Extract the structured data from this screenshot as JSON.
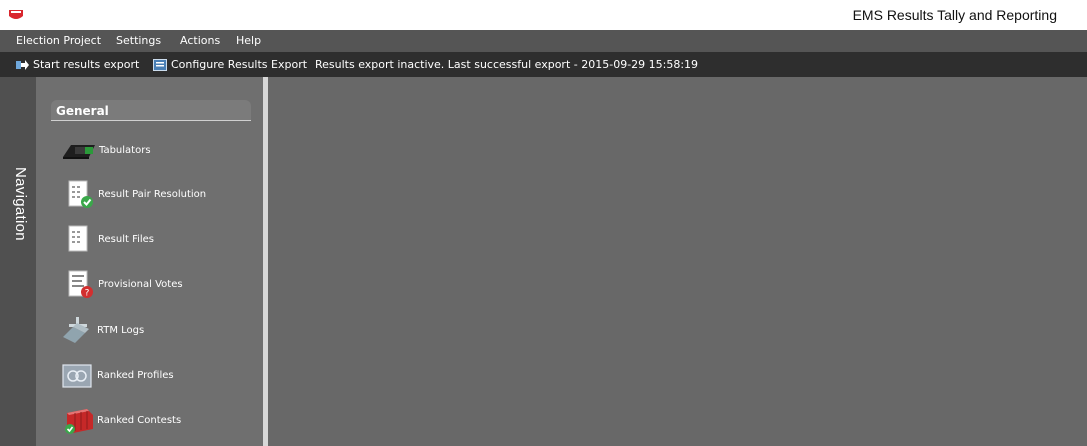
{
  "window": {
    "title": "EMS Results Tally and Reporting"
  },
  "menu": {
    "items": [
      {
        "label": "Election Project"
      },
      {
        "label": "Settings"
      },
      {
        "label": "Actions"
      },
      {
        "label": "Help"
      }
    ]
  },
  "toolbar": {
    "start_export": "Start results export",
    "configure_export": "Configure Results Export",
    "status": "Results export inactive. Last successful export - 2015-09-29 15:58:19"
  },
  "navigation": {
    "strip_label": "Navigation",
    "group_title": "General",
    "items": [
      {
        "label": "Tabulators",
        "icon": "tabulator-icon"
      },
      {
        "label": "Result Pair Resolution",
        "icon": "result-pair-icon"
      },
      {
        "label": "Result Files",
        "icon": "result-files-icon"
      },
      {
        "label": "Provisional Votes",
        "icon": "provisional-votes-icon"
      },
      {
        "label": "RTM Logs",
        "icon": "rtm-logs-icon"
      },
      {
        "label": "Ranked Profiles",
        "icon": "ranked-profiles-icon"
      },
      {
        "label": "Ranked Contests",
        "icon": "ranked-contests-icon"
      }
    ]
  },
  "colors": {
    "accent": "#d9272e",
    "toolbar_bg": "#2e2e2e",
    "menu_bg": "#555555",
    "content_bg": "#686868"
  }
}
